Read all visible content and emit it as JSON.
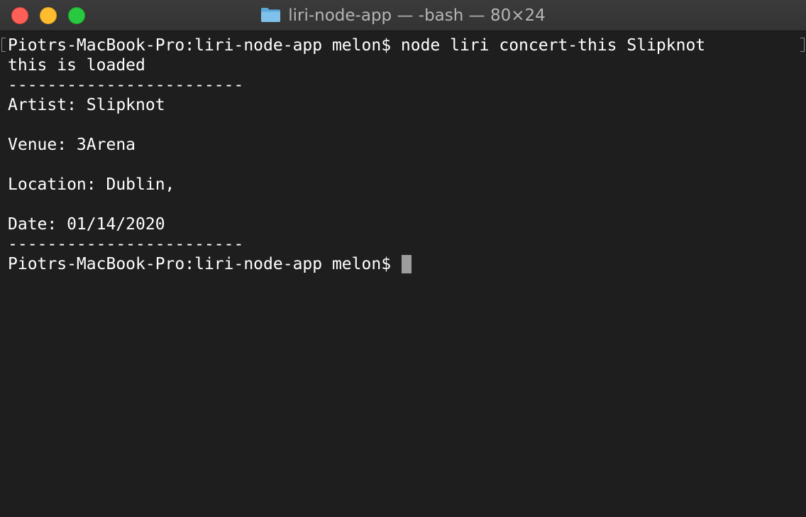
{
  "window": {
    "title": "liri-node-app — -bash — 80×24",
    "folder_icon": "folder-icon",
    "colors": {
      "close": "#fe5f57",
      "minimize": "#febc2e",
      "maximize": "#28c840",
      "background": "#1e1e1e",
      "text": "#ffffff"
    }
  },
  "terminal": {
    "lines": [
      "Piotrs-MacBook-Pro:liri-node-app melon$ node liri concert-this Slipknot",
      "this is loaded",
      "------------------------",
      "Artist: Slipknot",
      "",
      "Venue: 3Arena",
      "",
      "Location: Dublin,",
      "",
      "Date: 01/14/2020",
      "------------------------"
    ],
    "prompt": "Piotrs-MacBook-Pro:liri-node-app melon$ "
  }
}
